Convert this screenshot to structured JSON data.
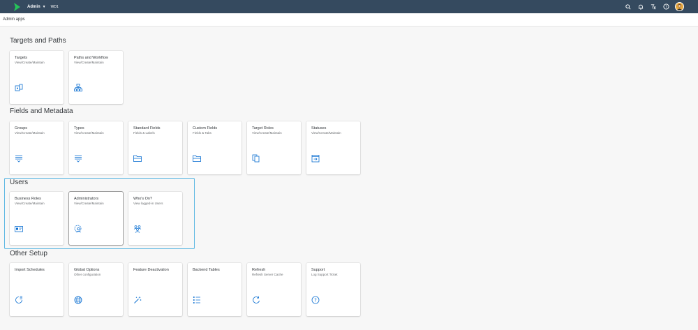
{
  "shell": {
    "title": "Admin",
    "subtitle": "WD1",
    "icons": [
      "search-icon",
      "bell-icon",
      "filter-icon",
      "help-icon",
      "avatar"
    ]
  },
  "subheader": {
    "label": "Admin apps"
  },
  "sections": [
    {
      "title": "Targets and Paths",
      "tiles": [
        {
          "title": "Targets",
          "subtitle": "View/Create/Maintain",
          "icon": "target-device-icon"
        },
        {
          "title": "Paths and Workflow",
          "subtitle": "View/Create/Maintain",
          "icon": "org-chart-icon"
        }
      ]
    },
    {
      "title": "Fields and Metadata",
      "tiles": [
        {
          "title": "Groups",
          "subtitle": "View/Create/Maintain",
          "icon": "list-down-icon"
        },
        {
          "title": "Types",
          "subtitle": "View/Create/Maintain",
          "icon": "list-down-icon"
        },
        {
          "title": "Standard Fields",
          "subtitle": "Fields & Labels",
          "icon": "folder-icon"
        },
        {
          "title": "Custom Fields",
          "subtitle": "Fields & Tabs",
          "icon": "folder-icon"
        },
        {
          "title": "Target Roles",
          "subtitle": "View/Create/Maintain",
          "icon": "copy-icon"
        },
        {
          "title": "Statuses",
          "subtitle": "View/Create/Maintain",
          "icon": "calendar-arrow-icon"
        }
      ]
    },
    {
      "title": "Users",
      "tiles": [
        {
          "title": "Business Roles",
          "subtitle": "View/Create/Maintain",
          "icon": "id-card-icon"
        },
        {
          "title": "Administrators",
          "subtitle": "View/Create/Maintain",
          "icon": "user-settings-icon"
        },
        {
          "title": "Who's On?",
          "subtitle": "View logged-in Users",
          "icon": "group-icon"
        }
      ]
    },
    {
      "title": "Other Setup",
      "tiles": [
        {
          "title": "Import Schedules",
          "subtitle": "",
          "icon": "schedule-icon"
        },
        {
          "title": "Global Options",
          "subtitle": "Other configuration",
          "icon": "globe-icon"
        },
        {
          "title": "Feature Deactivation",
          "subtitle": "",
          "icon": "magic-wand-icon"
        },
        {
          "title": "Backend Tables",
          "subtitle": "",
          "icon": "bullet-list-icon"
        },
        {
          "title": "Refresh",
          "subtitle": "Refresh Server Cache",
          "icon": "refresh-icon"
        },
        {
          "title": "Support",
          "subtitle": "Log Support Ticket",
          "icon": "question-icon"
        }
      ]
    }
  ],
  "colors": {
    "shell": "#354a5f",
    "accent": "#0a6ed1",
    "selection_frame": "#5eb8e3",
    "logo": "#26c45a"
  }
}
